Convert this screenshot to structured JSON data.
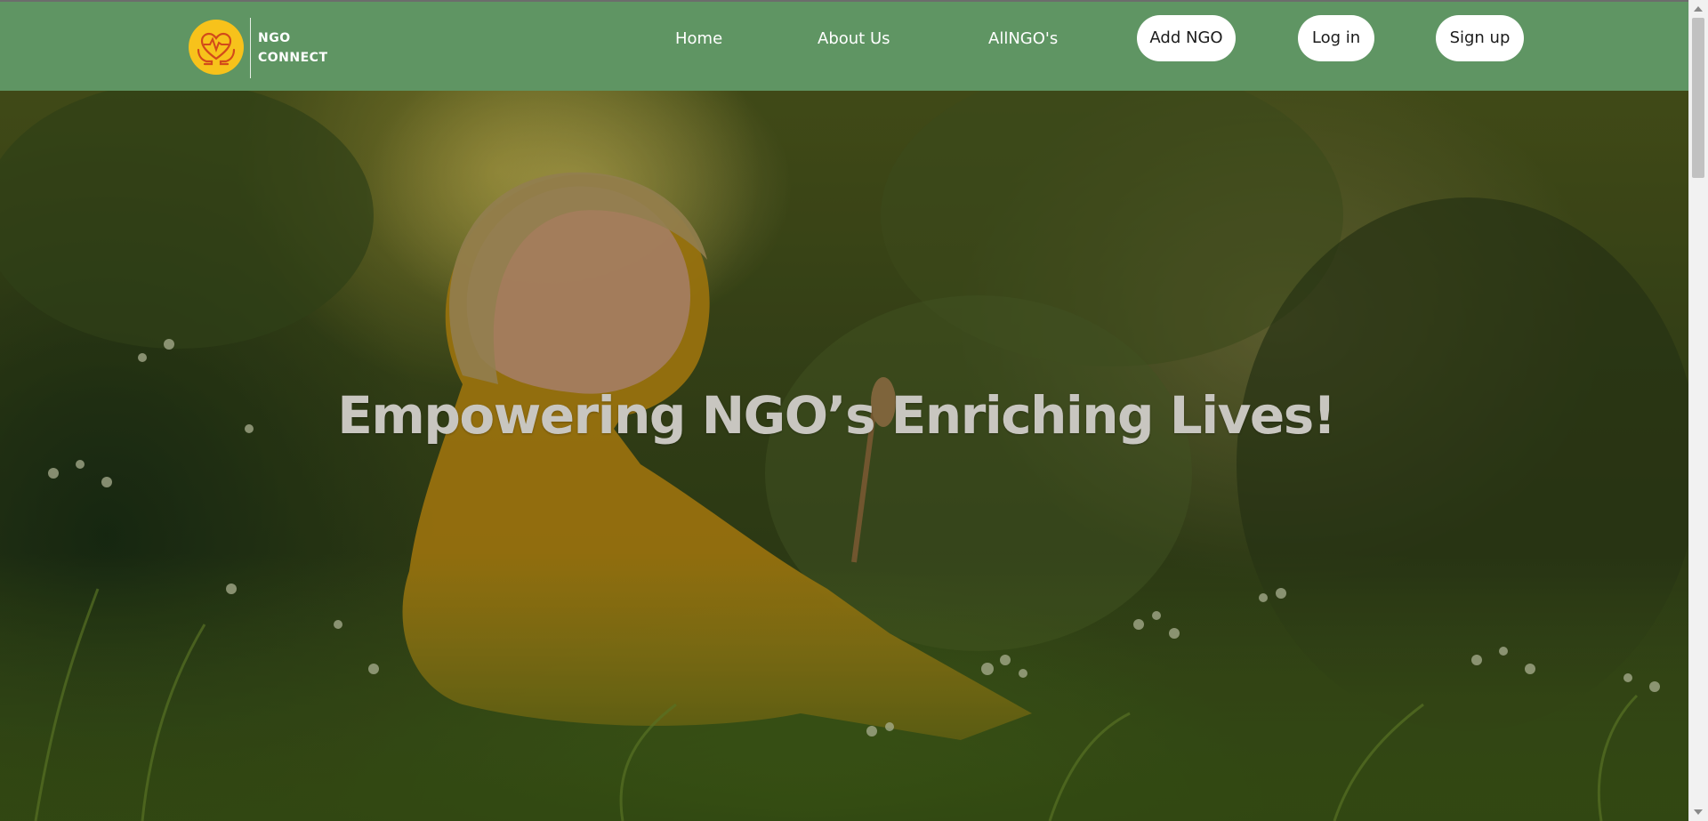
{
  "header": {
    "logo_icon": "hands-heart-pulse-icon",
    "logo_line1": "NGO",
    "logo_line2": "CONNECT",
    "brand_color": "#5f9563",
    "logo_color": "#f7c21b"
  },
  "nav": {
    "home": "Home",
    "about": "About Us",
    "all_ngos": "AllNGO's"
  },
  "actions": {
    "add_ngo": "Add NGO",
    "login": "Log in",
    "signup": "Sign up"
  },
  "hero": {
    "heading": "Empowering NGO’s Enriching Lives!",
    "image_subject": "hero-photo-girl-in-meadow"
  },
  "scrollbar": {
    "up_icon": "scroll-up-arrow-icon",
    "down_icon": "scroll-down-arrow-icon"
  }
}
